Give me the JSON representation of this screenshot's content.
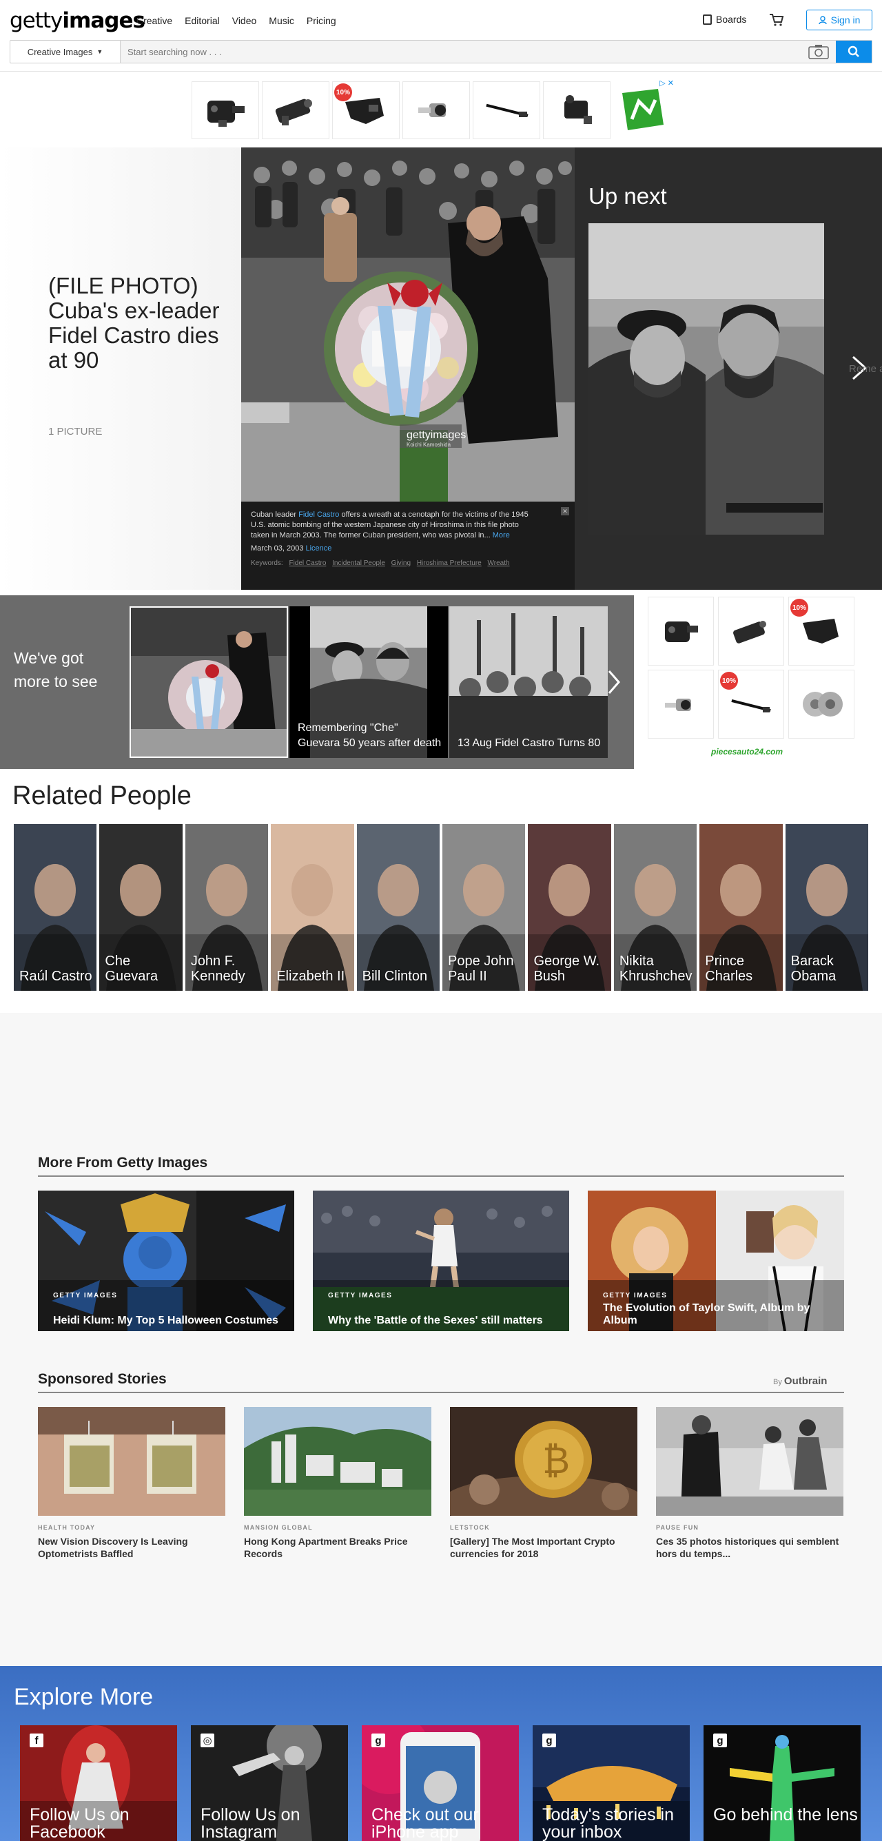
{
  "header": {
    "logo_regular": "getty",
    "logo_bold": "images",
    "nav": [
      "Creative",
      "Editorial",
      "Video",
      "Music",
      "Pricing"
    ],
    "boards_label": "Boards",
    "signin_label": "Sign in",
    "search_dropdown": "Creative Images",
    "search_placeholder": "Start searching now . . ."
  },
  "ad_top": {
    "badge": "10%"
  },
  "hero": {
    "title": "(FILE PHOTO) Cuba's ex-leader Fidel Castro dies at 90",
    "count": "1 PICTURE",
    "watermark": "gettyimages",
    "watermark_sub": "Koichi Kamoshida",
    "caption_pre": "Cuban leader",
    "caption_link": "Fidel Castro",
    "caption_post": "offers a wreath at a cenotaph for the victims of the 1945 U.S. atomic bombing of the western Japanese city of Hiroshima in this file photo taken in March 2003. The former Cuban president, who was pivotal in...",
    "caption_more": "More",
    "date": "March 03, 2003",
    "licence": "Licence",
    "keywords_label": "Keywords:",
    "keywords": [
      "Fidel Castro",
      "Incidental People",
      "Giving",
      "Hiroshima Prefecture",
      "Wreath"
    ],
    "upnext_label": "Up next",
    "ghost_text": "Reme after d"
  },
  "more": {
    "title": "We've got more to see",
    "items": [
      {
        "caption": ""
      },
      {
        "caption": "Remembering \"Che\" Guevara 50 years after death"
      },
      {
        "caption": "13 Aug Fidel Castro Turns 80"
      }
    ]
  },
  "side_ad": {
    "badge1": "10%",
    "badge2": "10%",
    "brand": "piecesauto24.com"
  },
  "related": {
    "title": "Related People",
    "people": [
      {
        "name": "Raúl Castro",
        "bg": "#3b4452"
      },
      {
        "name": "Che Guevara",
        "bg": "#2e2e2e"
      },
      {
        "name": "John F. Kennedy",
        "bg": "#6d6d6d"
      },
      {
        "name": "Elizabeth II",
        "bg": "#d9b8a0"
      },
      {
        "name": "Bill Clinton",
        "bg": "#5b6470"
      },
      {
        "name": "Pope John Paul II",
        "bg": "#8a8a8a"
      },
      {
        "name": "George W. Bush",
        "bg": "#5b3a3a"
      },
      {
        "name": "Nikita Khrushchev",
        "bg": "#7a7a7a"
      },
      {
        "name": "Prince Charles",
        "bg": "#7a4a3a"
      },
      {
        "name": "Barack Obama",
        "bg": "#3c4656"
      }
    ]
  },
  "more_from": {
    "title": "More From Getty Images",
    "cards": [
      {
        "tag": "GETTY IMAGES",
        "title": "Heidi Klum: My Top 5 Halloween Costumes"
      },
      {
        "tag": "GETTY IMAGES",
        "title": "Why the 'Battle of the Sexes' still matters"
      },
      {
        "tag": "GETTY IMAGES",
        "title": "The Evolution of Taylor Swift, Album by Album"
      }
    ]
  },
  "sponsored": {
    "title": "Sponsored Stories",
    "by": "By",
    "brand": "Outbrain",
    "cards": [
      {
        "source": "HEALTH TODAY",
        "title": "New Vision Discovery Is Leaving Optometrists Baffled"
      },
      {
        "source": "MANSION GLOBAL",
        "title": "Hong Kong Apartment Breaks Price Records"
      },
      {
        "source": "LETSTOCK",
        "title": "[Gallery] The Most Important Crypto currencies for 2018"
      },
      {
        "source": "PAUSE FUN",
        "title": "Ces 35 photos historiques qui semblent hors du temps..."
      }
    ]
  },
  "explore": {
    "title": "Explore More",
    "cards": [
      {
        "icon": "f",
        "title": "Follow Us on Facebook"
      },
      {
        "icon": "◎",
        "title": "Follow Us on Instagram"
      },
      {
        "icon": "g",
        "title": "Check out our iPhone app"
      },
      {
        "icon": "g",
        "title": "Today's stories in your inbox"
      },
      {
        "icon": "g",
        "title": "Go behind the lens"
      }
    ]
  }
}
